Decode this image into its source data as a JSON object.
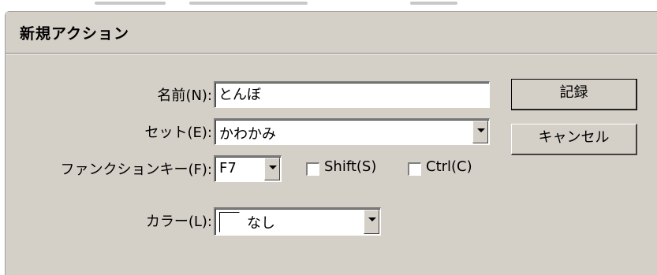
{
  "dialog": {
    "title": "新規アクション"
  },
  "form": {
    "name": {
      "label": "名前(N):",
      "value": "とんぼ"
    },
    "set": {
      "label": "セット(E):",
      "value": "かわかみ"
    },
    "function_key": {
      "label": "ファンクションキー(F):",
      "value": "F7"
    },
    "shift": {
      "label": "Shift(S)",
      "checked": false
    },
    "ctrl": {
      "label": "Ctrl(C)",
      "checked": false
    },
    "color": {
      "label": "カラー(L):",
      "value": "なし"
    }
  },
  "buttons": {
    "record_label": "記録",
    "cancel_label": "キャンセル"
  },
  "icons": {
    "dropdown": "chevron-down-icon",
    "color_swatch": "color-swatch-icon"
  },
  "colors": {
    "dialog_bg": "#d4d0c8",
    "field_bg": "#ffffff"
  }
}
